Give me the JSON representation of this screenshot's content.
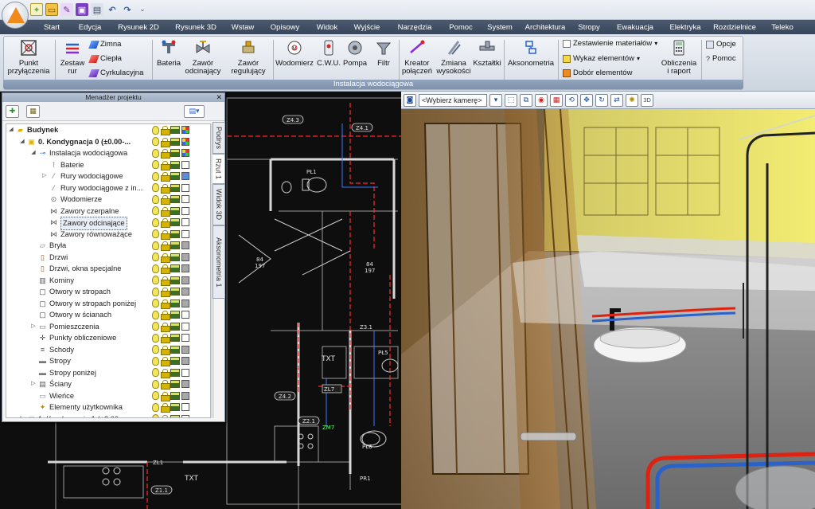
{
  "quick_access": {
    "icons": [
      "new-icon",
      "open-icon",
      "edit-icon",
      "save-icon",
      "print-icon",
      "undo-icon",
      "redo-icon"
    ],
    "more": "⌄"
  },
  "menu": [
    "Start",
    "Edycja",
    "Rysunek 2D",
    "Rysunek 3D",
    "Wstaw",
    "Opisowy",
    "Widok",
    "Wyjście",
    "Narzędzia",
    "Pomoc",
    "System",
    "Architektura",
    "Stropy",
    "Ewakuacja",
    "Elektryka",
    "Rozdzielnice",
    "Teleko"
  ],
  "ribbon": {
    "punkt": [
      "Punkt",
      "przyłączenia"
    ],
    "zestaw": [
      "Zestaw",
      "rur"
    ],
    "pipes": [
      "Zimna",
      "Ciepła",
      "Cyrkulacyjna"
    ],
    "bateria": "Bateria",
    "zawor_odc": [
      "Zawór",
      "odcinający"
    ],
    "zawor_reg": [
      "Zawór",
      "regulujący"
    ],
    "wodomierz": "Wodomierz",
    "cwu": "C.W.U.",
    "pompa": "Pompa",
    "filtr": "Filtr",
    "kreator": [
      "Kreator",
      "połączeń"
    ],
    "zmiana": [
      "Zmiana",
      "wysokości"
    ],
    "ksztaltki": "Kształtki",
    "aksonometria": "Aksonometria",
    "lists": [
      "Zestawienie materiałów",
      "Wykaz elementów",
      "Dobór elementów"
    ],
    "obliczenia": [
      "Obliczenia",
      "i raport"
    ],
    "opcje": "Opcje",
    "pomoc": "Pomoc",
    "group_label": "Instalacja wodociągowa"
  },
  "project_manager": {
    "title": "Menadżer projektu",
    "close": "✕",
    "tree": [
      {
        "label": "Budynek",
        "level": 0,
        "bold": true,
        "exp": "◢",
        "icon": "building"
      },
      {
        "label": "0. Kondygnacja 0 (±0.00-...",
        "level": 1,
        "bold": true,
        "exp": "◢",
        "icon": "floor"
      },
      {
        "label": "Instalacja wodociągowa",
        "level": 2,
        "exp": "◢",
        "icon": "water"
      },
      {
        "label": "Baterie",
        "level": 3,
        "icon": "tap"
      },
      {
        "label": "Rury wodociągowe",
        "level": 3,
        "exp": "▷",
        "icon": "pipe"
      },
      {
        "label": "Rury wodociągowe z in...",
        "level": 3,
        "icon": "pipe"
      },
      {
        "label": "Wodomierze",
        "level": 3,
        "icon": "meter"
      },
      {
        "label": "Zawory czerpalne",
        "level": 3,
        "icon": "valve"
      },
      {
        "label": "Zawory odcinające",
        "level": 3,
        "icon": "valve",
        "selected": true
      },
      {
        "label": "Zawory równoważące",
        "level": 3,
        "icon": "valve"
      },
      {
        "label": "Bryła",
        "level": 2,
        "icon": "solid"
      },
      {
        "label": "Drzwi",
        "level": 2,
        "icon": "door"
      },
      {
        "label": "Drzwi, okna specjalne",
        "level": 2,
        "icon": "door"
      },
      {
        "label": "Kominy",
        "level": 2,
        "icon": "chimney"
      },
      {
        "label": "Otwory w stropach",
        "level": 2,
        "icon": "hole"
      },
      {
        "label": "Otwory w stropach poniżej",
        "level": 2,
        "icon": "hole"
      },
      {
        "label": "Otwory w ścianach",
        "level": 2,
        "icon": "hole"
      },
      {
        "label": "Pomieszczenia",
        "level": 2,
        "exp": "▷",
        "icon": "room"
      },
      {
        "label": "Punkty obliczeniowe",
        "level": 2,
        "icon": "point"
      },
      {
        "label": "Schody",
        "level": 2,
        "icon": "stairs"
      },
      {
        "label": "Stropy",
        "level": 2,
        "icon": "slab"
      },
      {
        "label": "Stropy poniżej",
        "level": 2,
        "icon": "slab"
      },
      {
        "label": "Ściany",
        "level": 2,
        "exp": "▷",
        "icon": "wall"
      },
      {
        "label": "Wieńce",
        "level": 2,
        "icon": "beam"
      },
      {
        "label": "Elementy użytkownika",
        "level": 2,
        "icon": "user"
      },
      {
        "label": "1. Kondygnacja 1 (+3.00...",
        "level": 1,
        "exp": "▷",
        "icon": "floor"
      }
    ],
    "tabs": [
      "Podrys",
      "Rzut 1",
      "Widok 3D",
      "Aksonometria 1"
    ]
  },
  "cad_labels": {
    "pl1": "PŁ1",
    "r84a": "84",
    "r197a": "197",
    "r84b": "84",
    "r197b": "197",
    "txt1": "TXT",
    "pl5": "PŁ5",
    "zl7": "ZL7",
    "zm7": "ZM7",
    "pl6": "PŁ6",
    "txt2": "TXT",
    "pr1": "PR1",
    "z41": "Z4.1",
    "z42": "Z4.2",
    "z43": "Z4.3",
    "z21": "Z2.1",
    "z11": "Z1.1",
    "z31": "Z3.1",
    "zl1": "ZL1"
  },
  "view3d": {
    "camera_placeholder": "<Wybierz kamerę>"
  },
  "colors": {
    "menubar": "#3e4d61",
    "ribbon_group": "#8698b2",
    "accent_orange": "#f08a1c"
  }
}
